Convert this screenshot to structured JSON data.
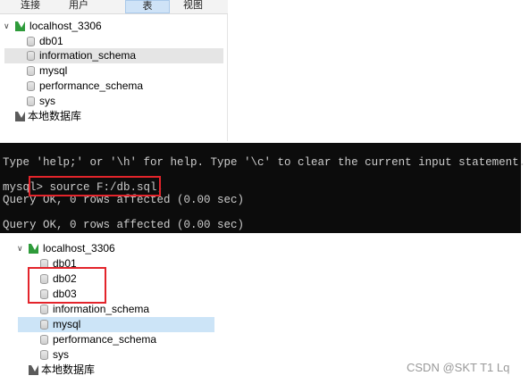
{
  "toolbar": {
    "items": [
      "连接",
      "用户",
      "表",
      "视图"
    ],
    "active_index": 2
  },
  "tree_before": {
    "connection": "localhost_3306",
    "databases": [
      "db01",
      "information_schema",
      "mysql",
      "performance_schema",
      "sys"
    ],
    "selected": "information_schema",
    "local_db": "本地数据库"
  },
  "terminal": {
    "lines": [
      "Type 'help;' or '\\h' for help. Type '\\c' to clear the current input statement.",
      "mysql> source F:/db.sql;",
      "Query OK, 0 rows affected (0.00 sec)",
      "Query OK, 0 rows affected (0.00 sec)"
    ]
  },
  "tree_after": {
    "connection": "localhost_3306",
    "databases": [
      "db01",
      "db02",
      "db03",
      "information_schema",
      "mysql",
      "performance_schema",
      "sys"
    ],
    "selected": "mysql",
    "local_db": "本地数据库"
  },
  "watermark": "CSDN @SKT T1 Lq",
  "colors": {
    "highlight_red": "#e3242b",
    "terminal_bg": "#0c0c0c",
    "terminal_text": "#cccccc",
    "connection_icon": "#2e9b3a",
    "selection_grey": "#e5e5e5",
    "selection_blue": "#cce4f7"
  }
}
